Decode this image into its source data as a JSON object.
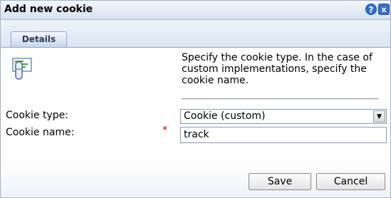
{
  "dialog": {
    "title": "Add new cookie",
    "help_icon": "?",
    "close_icon": "x"
  },
  "tabs": [
    {
      "label": "Details",
      "active": true
    }
  ],
  "content": {
    "icon": "cookie-card-icon",
    "description": "Specify the cookie type. In the case of custom implementations, specify the cookie name.",
    "cookie_type": {
      "label": "Cookie type:",
      "selected": "Cookie (custom)"
    },
    "cookie_name": {
      "label": "Cookie name:",
      "required_mark": "*",
      "value": "track"
    }
  },
  "buttons": {
    "save": "Save",
    "cancel": "Cancel"
  },
  "colors": {
    "titlebar": "#d6e0ef",
    "border": "#9fb1cc",
    "required": "#d00000",
    "help_button": "#2f6fcf"
  }
}
